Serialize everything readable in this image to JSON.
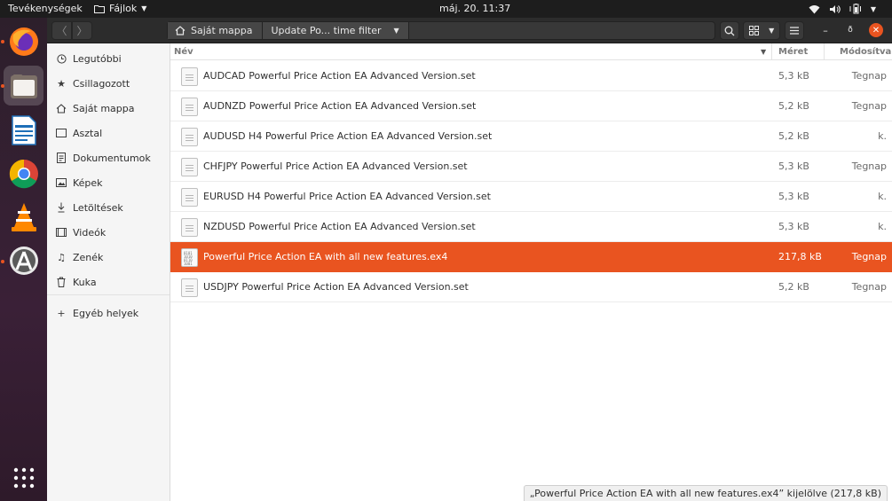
{
  "topbar": {
    "activities": "Tevékenységek",
    "app_menu": "Fájlok",
    "clock": "máj. 20.  11:37"
  },
  "dock": {
    "items": [
      "firefox-icon",
      "files-icon",
      "writer-icon",
      "chrome-icon",
      "vlc-icon",
      "software-icon"
    ],
    "show_apps": "apps-grid-icon"
  },
  "header": {
    "home_crumb": "Saját mappa",
    "current_crumb": "Update Po... time filter",
    "close_color": "#e95420"
  },
  "sidebar": {
    "items": [
      {
        "label": "Legutóbbi",
        "icon": "clock-icon"
      },
      {
        "label": "Csillagozott",
        "icon": "star-icon"
      },
      {
        "label": "Saját mappa",
        "icon": "home-icon"
      },
      {
        "label": "Asztal",
        "icon": "desktop-icon"
      },
      {
        "label": "Dokumentumok",
        "icon": "document-icon"
      },
      {
        "label": "Képek",
        "icon": "image-icon"
      },
      {
        "label": "Letöltések",
        "icon": "download-icon"
      },
      {
        "label": "Videók",
        "icon": "video-icon"
      },
      {
        "label": "Zenék",
        "icon": "music-icon"
      },
      {
        "label": "Kuka",
        "icon": "trash-icon"
      }
    ],
    "other_places": "Egyéb helyek"
  },
  "columns": {
    "name": "Név",
    "size": "Méret",
    "modified": "Módosítva"
  },
  "files": [
    {
      "name": "AUDCAD Powerful Price Action EA Advanced Version.set",
      "size": "5,3 kB",
      "modified": "Tegnap",
      "selected": false
    },
    {
      "name": "AUDNZD Powerful Price Action EA Advanced Version.set",
      "size": "5,2 kB",
      "modified": "Tegnap",
      "selected": false
    },
    {
      "name": "AUDUSD H4 Powerful Price Action EA Advanced Version.set",
      "size": "5,2 kB",
      "modified": "k.",
      "selected": false
    },
    {
      "name": "CHFJPY Powerful Price Action EA Advanced Version.set",
      "size": "5,3 kB",
      "modified": "Tegnap",
      "selected": false
    },
    {
      "name": "EURUSD H4 Powerful Price Action EA Advanced Version.set",
      "size": "5,3 kB",
      "modified": "k.",
      "selected": false
    },
    {
      "name": "NZDUSD Powerful Price Action EA Advanced Version.set",
      "size": "5,3 kB",
      "modified": "k.",
      "selected": false
    },
    {
      "name": "Powerful Price Action EA with all new features.ex4",
      "size": "217,8 kB",
      "modified": "Tegnap",
      "selected": true
    },
    {
      "name": "USDJPY Powerful Price Action EA Advanced Version.set",
      "size": "5,2 kB",
      "modified": "Tegnap",
      "selected": false
    }
  ],
  "status": "„Powerful Price Action EA with all new features.ex4” kijelölve  (217,8 kB)",
  "accent": "#e95420"
}
